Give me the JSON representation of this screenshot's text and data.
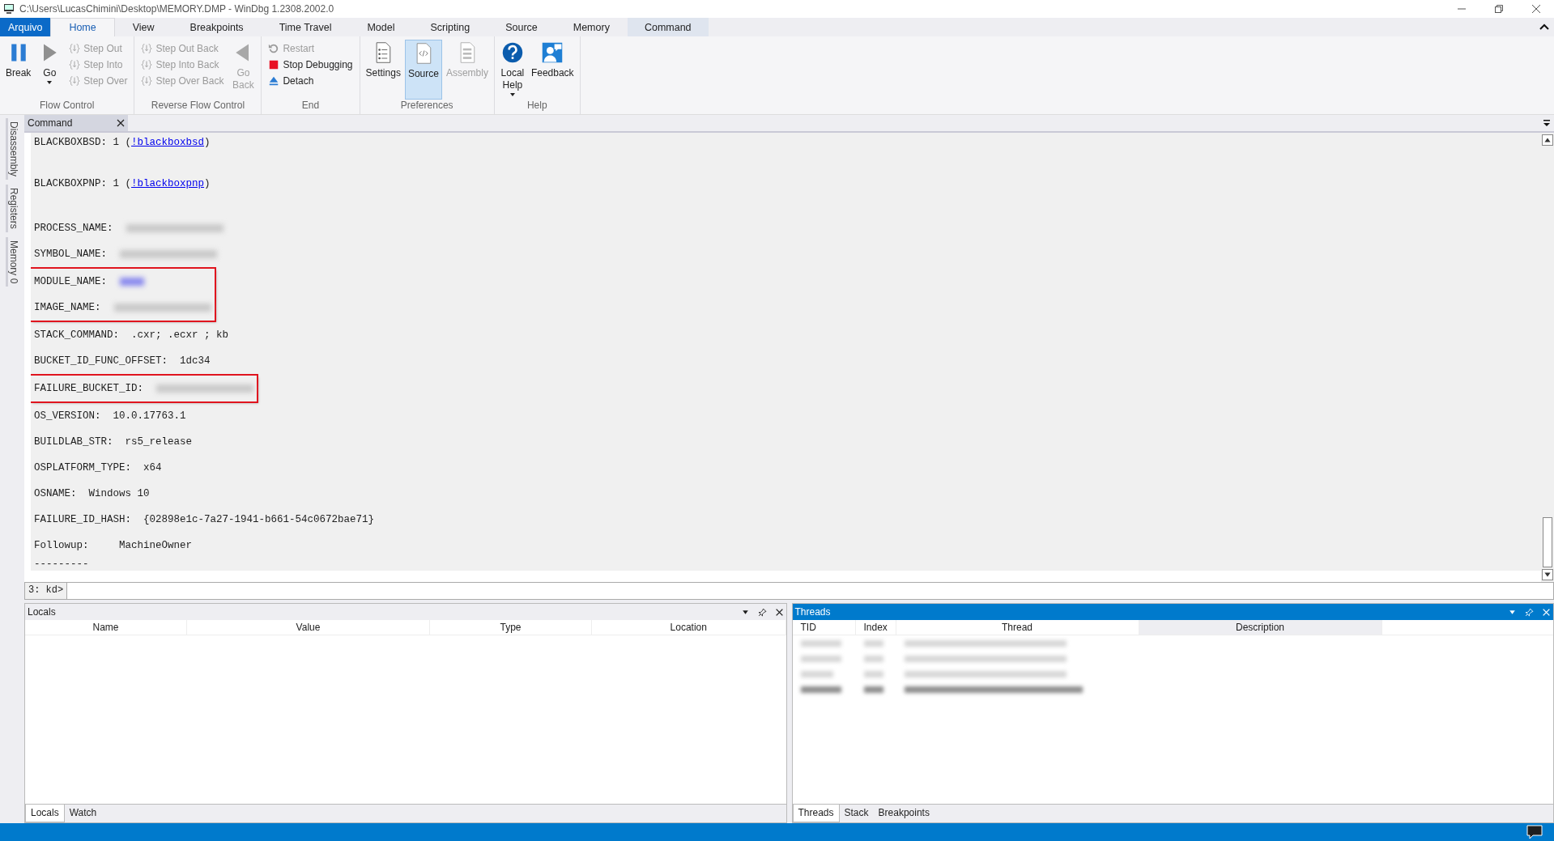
{
  "window": {
    "title": "C:\\Users\\LucasChimini\\Desktop\\MEMORY.DMP - WinDbg 1.2308.2002.0"
  },
  "ribbon_tabs": [
    {
      "label": "Arquivo",
      "kind": "file",
      "selected": false
    },
    {
      "label": "Home",
      "kind": "normal",
      "selected": true
    },
    {
      "label": "View",
      "kind": "normal",
      "selected": false
    },
    {
      "label": "Breakpoints",
      "kind": "normal",
      "selected": false
    },
    {
      "label": "Time Travel",
      "kind": "normal",
      "selected": false
    },
    {
      "label": "Model",
      "kind": "normal",
      "selected": false
    },
    {
      "label": "Scripting",
      "kind": "normal",
      "selected": false
    },
    {
      "label": "Source",
      "kind": "normal",
      "selected": false
    },
    {
      "label": "Memory",
      "kind": "normal",
      "selected": false
    },
    {
      "label": "Command",
      "kind": "contextual",
      "selected": false
    }
  ],
  "ribbon_groups": [
    {
      "label": "Flow Control",
      "items": [
        {
          "label": "Break",
          "kind": "large",
          "disabled": false,
          "dropdown": false,
          "selected": false
        },
        {
          "label": "Go",
          "kind": "large",
          "disabled": false,
          "dropdown": true,
          "selected": false
        },
        {
          "label": "Step Out",
          "kind": "small",
          "disabled": true
        },
        {
          "label": "Step Into",
          "kind": "small",
          "disabled": true
        },
        {
          "label": "Step Over",
          "kind": "small",
          "disabled": true
        }
      ]
    },
    {
      "label": "Reverse Flow Control",
      "items": [
        {
          "label": "Step Out Back",
          "kind": "small",
          "disabled": true
        },
        {
          "label": "Step Into Back",
          "kind": "small",
          "disabled": true
        },
        {
          "label": "Step Over Back",
          "kind": "small",
          "disabled": true
        },
        {
          "label": "Go Back",
          "kind": "large",
          "disabled": true,
          "dropdown": false,
          "selected": false
        }
      ]
    },
    {
      "label": "End",
      "items": [
        {
          "label": "Restart",
          "kind": "small",
          "disabled": true
        },
        {
          "label": "Stop Debugging",
          "kind": "small",
          "disabled": false
        },
        {
          "label": "Detach",
          "kind": "small",
          "disabled": false
        }
      ]
    },
    {
      "label": "Preferences",
      "items": [
        {
          "label": "Settings",
          "kind": "large",
          "disabled": false,
          "dropdown": false,
          "selected": false
        },
        {
          "label": "Source",
          "kind": "large",
          "disabled": false,
          "dropdown": false,
          "selected": true
        },
        {
          "label": "Assembly",
          "kind": "large",
          "disabled": true,
          "dropdown": false,
          "selected": false
        }
      ]
    },
    {
      "label": "Help",
      "items": [
        {
          "label": "Local Help",
          "kind": "large",
          "disabled": false,
          "dropdown": true,
          "selected": false
        },
        {
          "label": "Feedback",
          "kind": "large",
          "disabled": false,
          "dropdown": false,
          "selected": false
        }
      ]
    }
  ],
  "side_tabs": [
    "Disassembly",
    "Registers",
    "Memory 0"
  ],
  "document_tab": {
    "label": "Command"
  },
  "output": [
    {
      "highlighted": false,
      "lines": [
        {
          "kind": "link",
          "label": "BLACKBOXBSD: 1 (",
          "link": "!blackboxbsd",
          "suffix": ")"
        },
        {
          "kind": "link",
          "label": "BLACKBOXPNP: 1 (",
          "link": "!blackboxpnp",
          "suffix": ")"
        },
        {
          "kind": "redacted",
          "label": "PROCESS_NAME:"
        },
        {
          "kind": "redacted",
          "label": "SYMBOL_NAME:"
        }
      ]
    },
    {
      "highlighted": true,
      "lines": [
        {
          "kind": "redacted-link",
          "label": "MODULE_NAME:"
        },
        {
          "kind": "redacted",
          "label": "IMAGE_NAME:"
        }
      ]
    },
    {
      "highlighted": false,
      "lines": [
        {
          "kind": "text",
          "label": "STACK_COMMAND:  .cxr; .ecxr ; kb"
        },
        {
          "kind": "text",
          "label": "BUCKET_ID_FUNC_OFFSET:  1dc34"
        }
      ]
    },
    {
      "highlighted": true,
      "lines": [
        {
          "kind": "redacted",
          "label": "FAILURE_BUCKET_ID:"
        }
      ]
    },
    {
      "highlighted": false,
      "lines": [
        {
          "kind": "text",
          "label": "OS_VERSION:  10.0.17763.1"
        },
        {
          "kind": "text",
          "label": "BUILDLAB_STR:  rs5_release"
        },
        {
          "kind": "text",
          "label": "OSPLATFORM_TYPE:  x64"
        },
        {
          "kind": "text",
          "label": "OSNAME:  Windows 10"
        },
        {
          "kind": "text",
          "label": "FAILURE_ID_HASH:  {02898e1c-7a27-1941-b661-54c0672bae71}"
        },
        {
          "kind": "text",
          "label": "Followup:     MachineOwner"
        },
        {
          "kind": "rule",
          "label": "---------"
        }
      ]
    }
  ],
  "prompt": "3: kd>",
  "panels": [
    {
      "title": "Locals",
      "active": false,
      "columns": [
        {
          "label": "Name",
          "selected": false
        },
        {
          "label": "Value",
          "selected": false
        },
        {
          "label": "Type",
          "selected": false
        },
        {
          "label": "Location",
          "selected": false
        }
      ],
      "tabs": [
        {
          "label": "Locals",
          "selected": true
        },
        {
          "label": "Watch",
          "selected": false
        }
      ]
    },
    {
      "title": "Threads",
      "active": true,
      "columns": [
        {
          "label": "TID",
          "selected": false
        },
        {
          "label": "Index",
          "selected": false
        },
        {
          "label": "Thread",
          "selected": false
        },
        {
          "label": "Description",
          "selected": true
        }
      ],
      "rows": [
        {
          "current": false
        },
        {
          "current": false
        },
        {
          "current": false
        },
        {
          "current": true
        }
      ],
      "tabs": [
        {
          "label": "Threads",
          "selected": true
        },
        {
          "label": "Stack",
          "selected": false
        },
        {
          "label": "Breakpoints",
          "selected": false
        }
      ]
    }
  ]
}
